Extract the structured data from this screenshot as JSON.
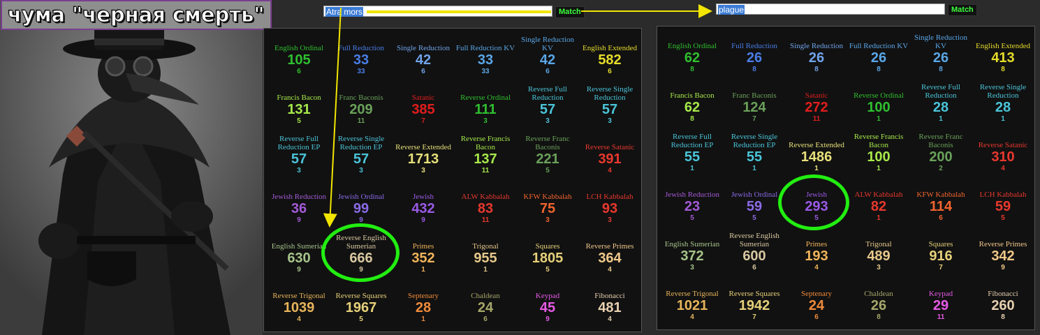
{
  "title": "чума \"черная смерть\"",
  "photo_icon": "plague-doctor-image",
  "left": {
    "search": {
      "value": "Atra mors",
      "button": "Match"
    },
    "rows": [
      [
        {
          "l": "English Ordinal",
          "v": "105",
          "s": "6",
          "c": "#2fbf2f"
        },
        {
          "l": "Full Reduction",
          "v": "33",
          "s": "33",
          "c": "#4a7de6"
        },
        {
          "l": "Single Reduction",
          "v": "42",
          "s": "6",
          "c": "#6fa3e8"
        },
        {
          "l": "Full Reduction KV",
          "v": "33",
          "s": "33",
          "c": "#5aa6e6"
        },
        {
          "l": "Single Reduction KV",
          "v": "42",
          "s": "6",
          "c": "#5aa6e6"
        },
        {
          "l": "English Extended",
          "v": "582",
          "s": "6",
          "c": "#e6dd2a"
        }
      ],
      [
        {
          "l": "Francis Bacon",
          "v": "131",
          "s": "5",
          "c": "#a6e84a"
        },
        {
          "l": "Franc Baconis",
          "v": "209",
          "s": "11",
          "c": "#6aa15a"
        },
        {
          "l": "Satanic",
          "v": "385",
          "s": "7",
          "c": "#e11d1d"
        },
        {
          "l": "Reverse Ordinal",
          "v": "111",
          "s": "3",
          "c": "#2fbf2f"
        },
        {
          "l": "Reverse Full Reduction",
          "v": "57",
          "s": "3",
          "c": "#4ac4d8"
        },
        {
          "l": "Reverse Single Reduction",
          "v": "57",
          "s": "3",
          "c": "#4ac4d8"
        }
      ],
      [
        {
          "l": "Reverse Full Reduction EP",
          "v": "57",
          "s": "3",
          "c": "#4ac4d8"
        },
        {
          "l": "Reverse Single Reduction EP",
          "v": "57",
          "s": "3",
          "c": "#4ac4d8"
        },
        {
          "l": "Reverse Extended",
          "v": "1713",
          "s": "3",
          "c": "#e6e07a"
        },
        {
          "l": "Reverse Francis Bacon",
          "v": "137",
          "s": "11",
          "c": "#a6e84a"
        },
        {
          "l": "Reverse Franc Baconis",
          "v": "221",
          "s": "5",
          "c": "#6aa15a"
        },
        {
          "l": "Reverse Satanic",
          "v": "391",
          "s": "4",
          "c": "#e8382e"
        }
      ],
      [
        {
          "l": "Jewish Reduction",
          "v": "36",
          "s": "9",
          "c": "#a35ad6"
        },
        {
          "l": "Jewish Ordinal",
          "v": "99",
          "s": "9",
          "c": "#8a6ae6"
        },
        {
          "l": "Jewish",
          "v": "432",
          "s": "9",
          "c": "#9a5ae6"
        },
        {
          "l": "ALW Kabbalah",
          "v": "83",
          "s": "11",
          "c": "#e6382e"
        },
        {
          "l": "KFW Kabbalah",
          "v": "75",
          "s": "3",
          "c": "#f0642e"
        },
        {
          "l": "LCH Kabbalah",
          "v": "93",
          "s": "3",
          "c": "#e8382e"
        }
      ],
      [
        {
          "l": "English Sumerian",
          "v": "630",
          "s": "9",
          "c": "#a6c48a"
        },
        {
          "l": "Reverse English Sumerian",
          "v": "666",
          "s": "9",
          "c": "#d8c8a0"
        },
        {
          "l": "Primes",
          "v": "352",
          "s": "1",
          "c": "#f0b45a"
        },
        {
          "l": "Trigonal",
          "v": "955",
          "s": "1",
          "c": "#e6c88a"
        },
        {
          "l": "Squares",
          "v": "1805",
          "s": "5",
          "c": "#e6d07a"
        },
        {
          "l": "Reverse Primes",
          "v": "364",
          "s": "4",
          "c": "#f0c88a"
        }
      ],
      [
        {
          "l": "Reverse Trigonal",
          "v": "1039",
          "s": "4",
          "c": "#e6b45a"
        },
        {
          "l": "Reverse Squares",
          "v": "1967",
          "s": "5",
          "c": "#e6d07a"
        },
        {
          "l": "Septenary",
          "v": "28",
          "s": "1",
          "c": "#f08a3a"
        },
        {
          "l": "Chaldean",
          "v": "24",
          "s": "6",
          "c": "#a6a66a"
        },
        {
          "l": "Keypad",
          "v": "45",
          "s": "9",
          "c": "#e65ae6"
        },
        {
          "l": "Fibonacci",
          "v": "481",
          "s": "4",
          "c": "#e6d0b0"
        }
      ]
    ]
  },
  "right": {
    "search": {
      "value": "plague",
      "button": "Match"
    },
    "rows": [
      [
        {
          "l": "English Ordinal",
          "v": "62",
          "s": "8",
          "c": "#2fbf2f"
        },
        {
          "l": "Full Reduction",
          "v": "26",
          "s": "8",
          "c": "#4a7de6"
        },
        {
          "l": "Single Reduction",
          "v": "26",
          "s": "8",
          "c": "#6fa3e8"
        },
        {
          "l": "Full Reduction KV",
          "v": "26",
          "s": "8",
          "c": "#5aa6e6"
        },
        {
          "l": "Single Reduction KV",
          "v": "26",
          "s": "8",
          "c": "#5aa6e6"
        },
        {
          "l": "English Extended",
          "v": "413",
          "s": "8",
          "c": "#e6dd2a"
        }
      ],
      [
        {
          "l": "Francis Bacon",
          "v": "62",
          "s": "8",
          "c": "#a6e84a"
        },
        {
          "l": "Franc Baconis",
          "v": "124",
          "s": "7",
          "c": "#6aa15a"
        },
        {
          "l": "Satanic",
          "v": "272",
          "s": "11",
          "c": "#e11d1d"
        },
        {
          "l": "Reverse Ordinal",
          "v": "100",
          "s": "1",
          "c": "#2fbf2f"
        },
        {
          "l": "Reverse Full Reduction",
          "v": "28",
          "s": "1",
          "c": "#4ac4d8"
        },
        {
          "l": "Reverse Single Reduction",
          "v": "28",
          "s": "1",
          "c": "#4ac4d8"
        }
      ],
      [
        {
          "l": "Reverse Full Reduction EP",
          "v": "55",
          "s": "1",
          "c": "#4ac4d8"
        },
        {
          "l": "Reverse Single Reduction EP",
          "v": "55",
          "s": "1",
          "c": "#4ac4d8"
        },
        {
          "l": "Reverse Extended",
          "v": "1486",
          "s": "1",
          "c": "#e6e07a"
        },
        {
          "l": "Reverse Francis Bacon",
          "v": "100",
          "s": "1",
          "c": "#a6e84a"
        },
        {
          "l": "Reverse Franc Baconis",
          "v": "200",
          "s": "2",
          "c": "#6aa15a"
        },
        {
          "l": "Reverse Satanic",
          "v": "310",
          "s": "4",
          "c": "#e8382e"
        }
      ],
      [
        {
          "l": "Jewish Reduction",
          "v": "23",
          "s": "5",
          "c": "#a35ad6"
        },
        {
          "l": "Jewish Ordinal",
          "v": "59",
          "s": "5",
          "c": "#8a6ae6"
        },
        {
          "l": "Jewish",
          "v": "293",
          "s": "5",
          "c": "#9a5ae6"
        },
        {
          "l": "ALW Kabbalah",
          "v": "82",
          "s": "1",
          "c": "#e6382e"
        },
        {
          "l": "KFW Kabbalah",
          "v": "114",
          "s": "6",
          "c": "#f0642e"
        },
        {
          "l": "LCH Kabbalah",
          "v": "59",
          "s": "5",
          "c": "#e8382e"
        }
      ],
      [
        {
          "l": "English Sumerian",
          "v": "372",
          "s": "3",
          "c": "#a6c48a"
        },
        {
          "l": "Reverse English Sumerian",
          "v": "600",
          "s": "6",
          "c": "#d8c8a0"
        },
        {
          "l": "Primes",
          "v": "193",
          "s": "4",
          "c": "#f0b45a"
        },
        {
          "l": "Trigonal",
          "v": "489",
          "s": "3",
          "c": "#e6c88a"
        },
        {
          "l": "Squares",
          "v": "916",
          "s": "7",
          "c": "#e6d07a"
        },
        {
          "l": "Reverse Primes",
          "v": "342",
          "s": "9",
          "c": "#f0c88a"
        }
      ],
      [
        {
          "l": "Reverse Trigonal",
          "v": "1021",
          "s": "4",
          "c": "#e6b45a"
        },
        {
          "l": "Reverse Squares",
          "v": "1942",
          "s": "7",
          "c": "#e6d07a"
        },
        {
          "l": "Septenary",
          "v": "24",
          "s": "6",
          "c": "#f08a3a"
        },
        {
          "l": "Chaldean",
          "v": "26",
          "s": "8",
          "c": "#a6a66a"
        },
        {
          "l": "Keypad",
          "v": "29",
          "s": "11",
          "c": "#e65ae6"
        },
        {
          "l": "Fibonacci",
          "v": "260",
          "s": "8",
          "c": "#e6d0b0"
        }
      ]
    ]
  },
  "colors": {
    "highlight_circle": "#22ee11",
    "arrow": "#f2e600"
  }
}
